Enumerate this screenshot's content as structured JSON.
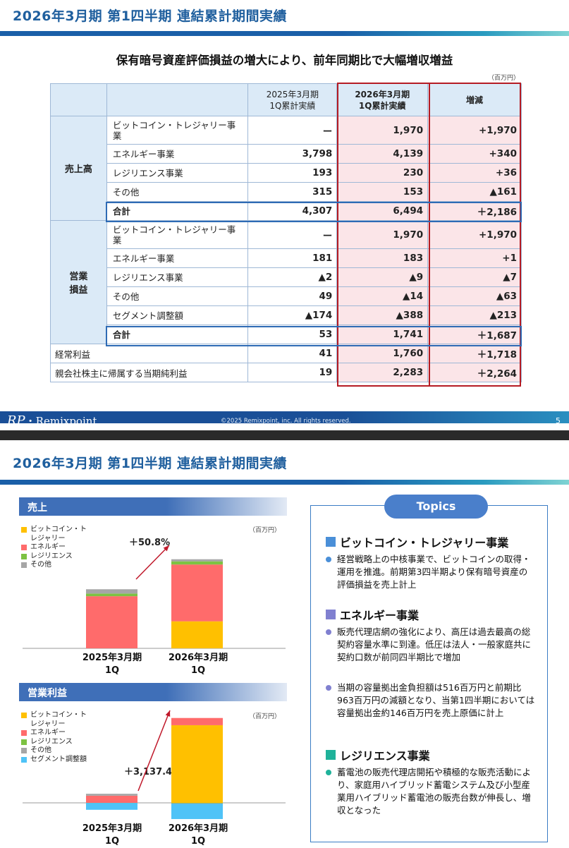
{
  "slide1": {
    "title": "2026年3月期 第1四半期 連結累計期間実績",
    "headline": "保有暗号資産評価損益の増大により、前年同期比で大幅増収増益",
    "unit": "（百万円）",
    "columns": {
      "prev_l1": "2025年3月期",
      "prev_l2": "1Q累計実績",
      "curr_l1": "2026年3月期",
      "curr_l2": "1Q累計実績",
      "diff": "増減"
    },
    "sales": {
      "group": "売上高",
      "rows": [
        {
          "item": "ビットコイン・トレジャリー事業",
          "prev": "ー",
          "curr": "1,970",
          "diff": "+1,970"
        },
        {
          "item": "エネルギー事業",
          "prev": "3,798",
          "curr": "4,139",
          "diff": "+340"
        },
        {
          "item": "レジリエンス事業",
          "prev": "193",
          "curr": "230",
          "diff": "+36"
        },
        {
          "item": "その他",
          "prev": "315",
          "curr": "153",
          "diff": "▲161"
        },
        {
          "item": "合計",
          "prev": "4,307",
          "curr": "6,494",
          "diff": "＋2,186"
        }
      ]
    },
    "op": {
      "group_l1": "営業",
      "group_l2": "損益",
      "rows": [
        {
          "item": "ビットコイン・トレジャリー事業",
          "prev": "ー",
          "curr": "1,970",
          "diff": "+1,970"
        },
        {
          "item": "エネルギー事業",
          "prev": "181",
          "curr": "183",
          "diff": "+1"
        },
        {
          "item": "レジリエンス事業",
          "prev": "▲2",
          "curr": "▲9",
          "diff": "▲7"
        },
        {
          "item": "その他",
          "prev": "49",
          "curr": "▲14",
          "diff": "▲63"
        },
        {
          "item": "セグメント調整額",
          "prev": "▲174",
          "curr": "▲388",
          "diff": "▲213"
        },
        {
          "item": "合計",
          "prev": "53",
          "curr": "1,741",
          "diff": "＋1,687"
        }
      ]
    },
    "ordinary": {
      "item": "経常利益",
      "prev": "41",
      "curr": "1,760",
      "diff": "＋1,718"
    },
    "net": {
      "item": "親会社株主に帰属する当期純利益",
      "prev": "19",
      "curr": "2,283",
      "diff": "＋2,264"
    },
    "footer": {
      "logo_mark": "RP",
      "logo_text": "・Remixpoint",
      "copyright": "©2025 Remixpoint, inc. All rights reserved.",
      "page": "5"
    }
  },
  "slide2": {
    "title": "2026年3月期 第1四半期 連結累計期間実績",
    "sales_head": "売上",
    "op_head": "営業利益",
    "unit": "（百万円）",
    "sales_growth": "＋50.8%",
    "op_growth": "＋3,137.4%",
    "colors": {
      "btc": "#ffc000",
      "energy": "#ff6b6b",
      "resilience": "#7dc242",
      "other": "#a6a6a6",
      "adjust": "#4fc3f7"
    },
    "sales_legend": [
      {
        "label": "ビットコイン・トレジャリー",
        "color": "#ffc000"
      },
      {
        "label": "エネルギー",
        "color": "#ff6b6b"
      },
      {
        "label": "レジリエンス",
        "color": "#7dc242"
      },
      {
        "label": "その他",
        "color": "#a6a6a6"
      }
    ],
    "op_legend": [
      {
        "label": "ビットコイン・トレジャリー",
        "color": "#ffc000"
      },
      {
        "label": "エネルギー",
        "color": "#ff6b6b"
      },
      {
        "label": "レジリエンス",
        "color": "#7dc242"
      },
      {
        "label": "その他",
        "color": "#a6a6a6"
      },
      {
        "label": "セグメント調整額",
        "color": "#4fc3f7"
      }
    ],
    "x_labels": [
      {
        "l1": "2025年3月期",
        "l2": "1Q"
      },
      {
        "l1": "2026年3月期",
        "l2": "1Q"
      }
    ],
    "topics": {
      "pill": "Topics",
      "sections": [
        {
          "heading": "ビットコイン・トレジャリー事業",
          "color": "#4a8fd8",
          "bullets": [
            "経営戦略上の中核事業で、ビットコインの取得・運用を推進。前期第3四半期より保有暗号資産の評価損益を売上計上"
          ]
        },
        {
          "heading": "エネルギー事業",
          "color": "#8080d0",
          "bullets": [
            "販売代理店網の強化により、高圧は過去最高の総契約容量水準に到達。低圧は法人・一般家庭共に契約口数が前同四半期比で増加",
            "当期の容量拠出金負担額は516百万円と前期比963百万円の減額となり、当第1四半期においては容量拠出金約146百万円を売上原価に計上"
          ]
        },
        {
          "heading": "レジリエンス事業",
          "color": "#1fb29a",
          "bullets": [
            "蓄電池の販売代理店開拓や積極的な販売活動により、家庭用ハイブリッド蓄電システム及び小型産業用ハイブリッド蓄電池の販売台数が伸長し、増収となった"
          ]
        }
      ]
    }
  },
  "chart_data": [
    {
      "type": "bar",
      "stacked": true,
      "title": "売上",
      "categories": [
        "2025年3月期 1Q",
        "2026年3月期 1Q"
      ],
      "series": [
        {
          "name": "ビットコイン・トレジャリー",
          "values": [
            0,
            1970
          ]
        },
        {
          "name": "エネルギー",
          "values": [
            3798,
            4139
          ]
        },
        {
          "name": "レジリエンス",
          "values": [
            193,
            230
          ]
        },
        {
          "name": "その他",
          "values": [
            315,
            153
          ]
        }
      ],
      "annotation": "＋50.8%"
    },
    {
      "type": "bar",
      "stacked": true,
      "title": "営業利益",
      "categories": [
        "2025年3月期 1Q",
        "2026年3月期 1Q"
      ],
      "series": [
        {
          "name": "ビットコイン・トレジャリー",
          "values": [
            0,
            1970
          ]
        },
        {
          "name": "エネルギー",
          "values": [
            181,
            183
          ]
        },
        {
          "name": "レジリエンス",
          "values": [
            -2,
            -9
          ]
        },
        {
          "name": "その他",
          "values": [
            49,
            -14
          ]
        },
        {
          "name": "セグメント調整額",
          "values": [
            -174,
            -388
          ]
        }
      ],
      "annotation": "＋3,137.4%"
    }
  ]
}
